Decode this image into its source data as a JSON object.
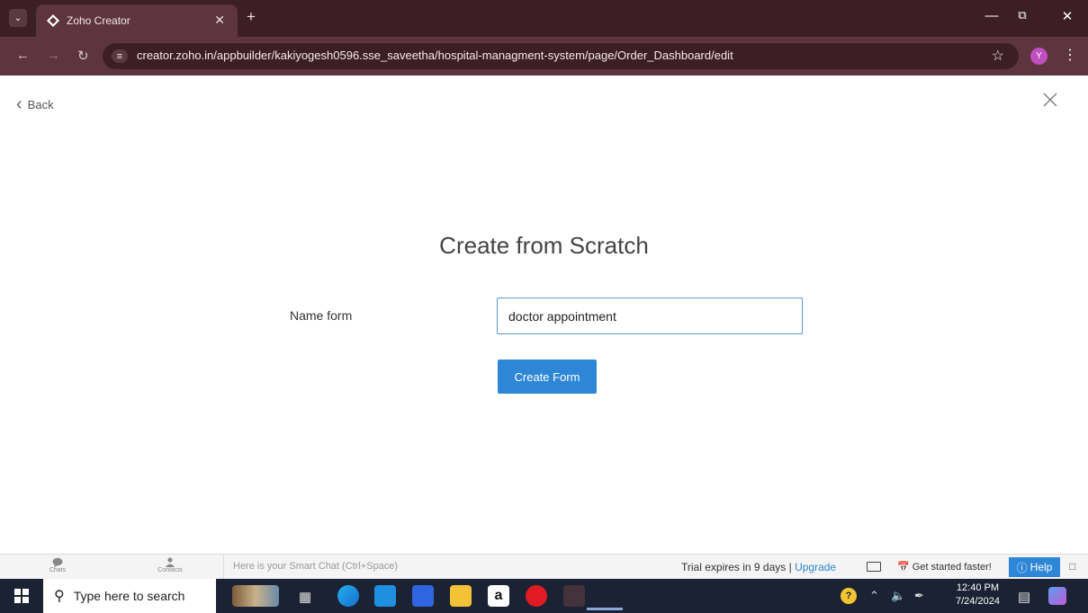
{
  "browser": {
    "tab_title": "Zoho Creator",
    "url": "creator.zoho.in/appbuilder/kakiyogesh0596.sse_saveetha/hospital-managment-system/page/Order_Dashboard/edit",
    "profile_initial": "Y"
  },
  "page": {
    "back_label": "Back",
    "heading": "Create from Scratch",
    "name_label": "Name form",
    "name_value": "doctor appointment",
    "create_button": "Create Form"
  },
  "zoho_bar": {
    "chats_label": "Chats",
    "contacts_label": "Contacts",
    "smart_chat_placeholder": "Here is your Smart Chat (Ctrl+Space)",
    "trial_text": "Trial expires in 9 days |",
    "upgrade_label": "Upgrade",
    "get_started_label": "Get started faster!",
    "help_label": "Help"
  },
  "taskbar": {
    "search_placeholder": "Type here to search",
    "time": "12:40 PM",
    "date": "7/24/2024"
  },
  "colors": {
    "accent": "#2e86d6",
    "browser_frame": "#3c1f26",
    "toolbar": "#5e3440",
    "taskbar": "#1b2233"
  }
}
